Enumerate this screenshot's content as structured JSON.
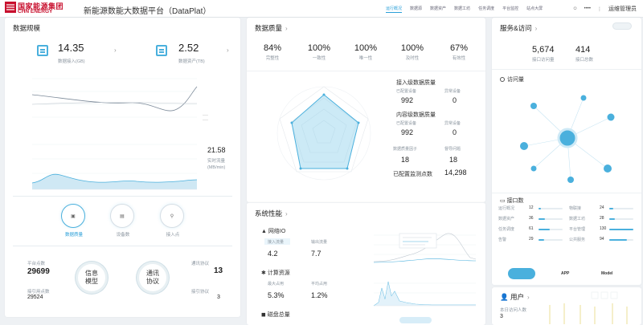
{
  "app": {
    "logo_cn": "国家能源集团",
    "logo_en": "CHN ENERGY",
    "title": "新能源数能大数据平台（DataPlat）"
  },
  "nav": [
    "运行概况",
    "数据源",
    "数据资产",
    "数据工坊",
    "任务调度",
    "平台监控",
    "站点大屏"
  ],
  "user": {
    "name": "••••",
    "admin_label": "运维管理员"
  },
  "colors": {
    "accent": "#4ab0dd",
    "brand": "#c8102e"
  },
  "scale": {
    "title": "数据规模",
    "stat1": {
      "value": "14.35",
      "label": "数据接入(GB)"
    },
    "stat2": {
      "value": "2.52",
      "label": "数据资产(TB)"
    },
    "rate": {
      "value": "21.58",
      "label1": "实时流量",
      "label2": "(MB/min)"
    },
    "buttons": [
      "数据质量",
      "设备数",
      "接入点"
    ],
    "left_block": {
      "label1": "平台点数",
      "value1": "29699",
      "label2": "接引用点数",
      "value2": "29524"
    },
    "circle1": [
      "信息",
      "模型"
    ],
    "circle2": [
      "通讯",
      "协议"
    ],
    "right_block": {
      "label1": "通讯协议",
      "value1": "13",
      "label2": "接引协议",
      "value2": "3"
    }
  },
  "quality": {
    "title": "数据质量",
    "stats": [
      {
        "value": "84%",
        "label": "完整性"
      },
      {
        "value": "100%",
        "label": "一致性"
      },
      {
        "value": "100%",
        "label": "唯一性"
      },
      {
        "value": "100%",
        "label": "及时性"
      },
      {
        "value": "67%",
        "label": "有效性"
      }
    ],
    "access": {
      "title": "接入级数据质量",
      "l1": "已配置设备",
      "l2": "异常设备",
      "v1": "992",
      "v2": "0"
    },
    "content": {
      "title": "内容级数据质量",
      "l1": "已配置设备",
      "l2": "异常设备",
      "v1": "992",
      "v2": "0"
    },
    "rules": {
      "l1": "数据质量因子",
      "l2": "督导问题",
      "v1": "18",
      "v2": "18",
      "points_label": "已配置监测点数",
      "points_value": "14,298"
    }
  },
  "perf": {
    "title": "系统性能",
    "io": {
      "title": "网络IO",
      "l1": "接入流量",
      "l2": "输出流量",
      "v1": "4.2",
      "v2": "7.7"
    },
    "compute": {
      "title": "计算资源",
      "l1": "最大占用",
      "l2": "平均占用",
      "v1": "5.3%",
      "v2": "1.2%"
    },
    "disk": {
      "title": "磁盘总量"
    }
  },
  "service": {
    "title": "服务&访问",
    "stat1": {
      "value": "5,674",
      "label": "接口访问量"
    },
    "stat2": {
      "value": "414",
      "label": "接口总数"
    },
    "visits_title": "访问量",
    "api_title": "接口数",
    "api_rows": [
      {
        "name": "运行概况",
        "value": "12",
        "frac": 0.09
      },
      {
        "name": "数据资产",
        "value": "36",
        "frac": 0.28
      },
      {
        "name": "任务调度",
        "value": "61",
        "frac": 0.47
      },
      {
        "name": "告警",
        "value": "29",
        "frac": 0.22
      },
      {
        "name": "物联接",
        "value": "24",
        "frac": 0.18
      },
      {
        "name": "数据工坊",
        "value": "28",
        "frac": 0.22
      },
      {
        "name": "平台管理",
        "value": "130",
        "frac": 1.0
      },
      {
        "name": "公共服务",
        "value": "94",
        "frac": 0.72
      }
    ],
    "tabs": [
      "",
      "APP",
      "Model"
    ]
  },
  "users": {
    "title": "用户",
    "label": "本日访问人数",
    "value": "3"
  }
}
